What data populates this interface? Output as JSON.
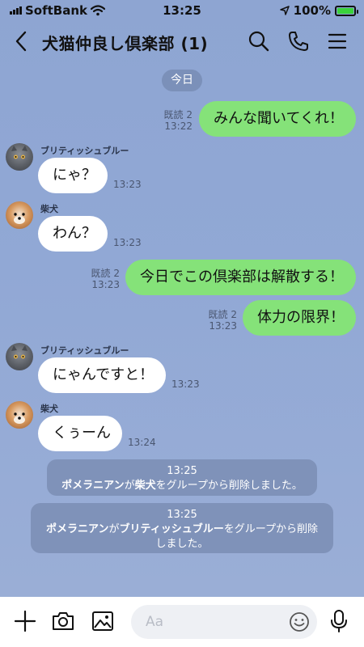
{
  "status_bar": {
    "carrier": "SoftBank",
    "time": "13:25",
    "battery": "100%"
  },
  "header": {
    "title": "犬猫仲良し倶楽部 (1)"
  },
  "date_separator": "今日",
  "messages": [
    {
      "type": "me",
      "text": "みんな聞いてくれ！",
      "read": "既読 2",
      "time": "13:22"
    },
    {
      "type": "other",
      "sender": "ブリティッシュブルー",
      "avatar": "cat-avatar",
      "text": "にゃ？",
      "time": "13:23"
    },
    {
      "type": "other",
      "sender": "柴犬",
      "avatar": "dog-avatar",
      "text": "わん？",
      "time": "13:23"
    },
    {
      "type": "me",
      "text": "今日でこの倶楽部は解散する！",
      "read": "既読 2",
      "time": "13:23"
    },
    {
      "type": "me",
      "text": "体力の限界！",
      "read": "既読 2",
      "time": "13:23"
    },
    {
      "type": "other",
      "sender": "ブリティッシュブルー",
      "avatar": "cat-avatar",
      "text": "にゃんですと！",
      "time": "13:23"
    },
    {
      "type": "other",
      "sender": "柴犬",
      "avatar": "dog-avatar",
      "text": "くぅーん",
      "time": "13:24"
    }
  ],
  "system_messages": [
    {
      "time": "13:25",
      "actor": "ポメラニアン",
      "mid1": "が",
      "target": "柴犬",
      "rest": "をグループから削除しました。"
    },
    {
      "time": "13:25",
      "actor": "ポメラニアン",
      "mid1": "が",
      "target": "ブリティッシュブルー",
      "rest_line1": "をグループから削除",
      "rest_line2": "しました。"
    }
  ],
  "input": {
    "placeholder": "Aa"
  },
  "colors": {
    "chat_background": "#8fa6d3",
    "my_bubble": "#85e279",
    "other_bubble": "#ffffff",
    "system_pill": "#7f92b9",
    "battery_fill": "#3bd23b"
  },
  "icons": [
    "back-icon",
    "search-icon",
    "phone-icon",
    "menu-icon",
    "plus-icon",
    "camera-icon",
    "image-icon",
    "emoji-icon",
    "mic-icon",
    "wifi-icon",
    "location-arrow-icon"
  ]
}
